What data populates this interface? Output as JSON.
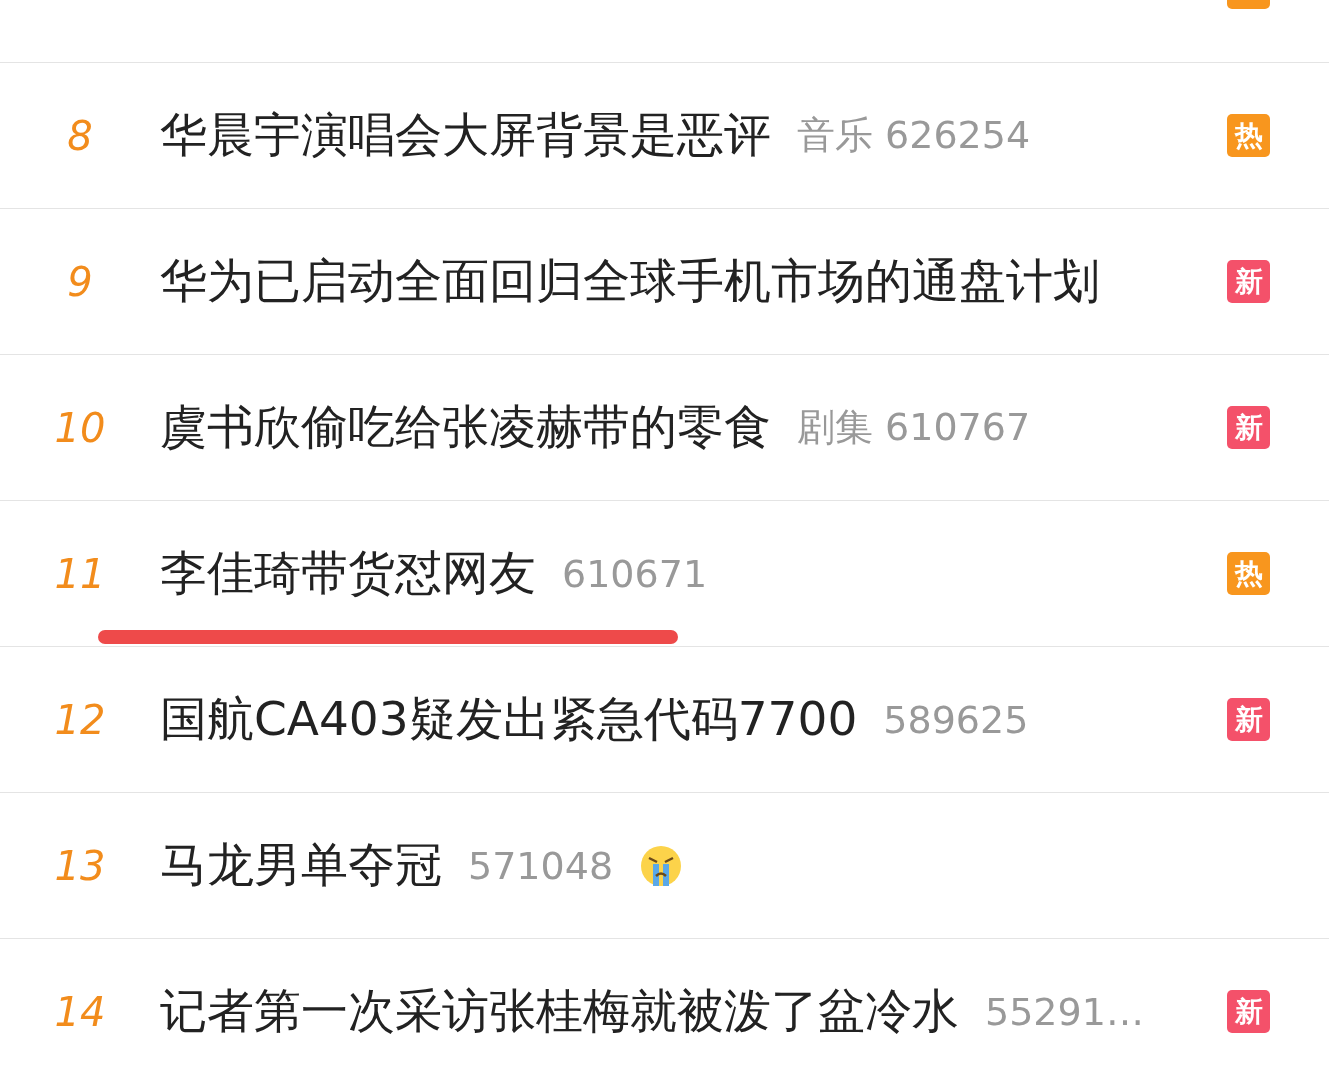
{
  "cut_row": {
    "badge": {
      "color": "#f8961e"
    }
  },
  "rows": [
    {
      "rank": "8",
      "title": "华晨宇演唱会大屏背景是恶评",
      "meta": "音乐 626254",
      "badge": {
        "text": "热",
        "color": "#f8961e"
      },
      "underlined": false,
      "crying_emoji": false
    },
    {
      "rank": "9",
      "title": "华为已启动全面回归全球手机市场的通盘计划",
      "badge": {
        "text": "新",
        "color": "#f4516a"
      },
      "underlined": false,
      "crying_emoji": false
    },
    {
      "rank": "10",
      "title": "虞书欣偷吃给张凌赫带的零食",
      "meta": "剧集 610767",
      "badge": {
        "text": "新",
        "color": "#f4516a"
      },
      "underlined": false,
      "crying_emoji": false
    },
    {
      "rank": "11",
      "title": "李佳琦带货怼网友",
      "meta": "610671",
      "badge": {
        "text": "热",
        "color": "#f8961e"
      },
      "underlined": true,
      "crying_emoji": false
    },
    {
      "rank": "12",
      "title": "国航CA403疑发出紧急代码7700",
      "meta": "589625",
      "badge": {
        "text": "新",
        "color": "#f4516a"
      },
      "underlined": false,
      "crying_emoji": false
    },
    {
      "rank": "13",
      "title": "马龙男单夺冠",
      "meta": "571048",
      "underlined": false,
      "crying_emoji": true
    },
    {
      "rank": "14",
      "title": "记者第一次采访张桂梅就被泼了盆冷水",
      "meta": "55291…",
      "badge": {
        "text": "新",
        "color": "#f4516a"
      },
      "underlined": false,
      "crying_emoji": false
    }
  ]
}
